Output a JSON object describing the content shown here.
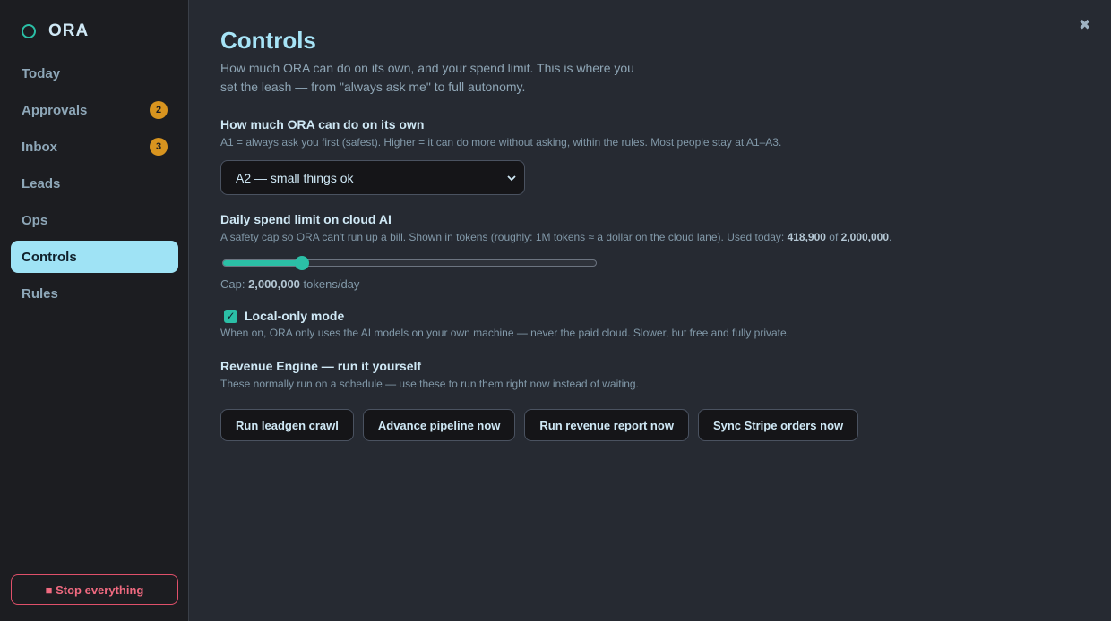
{
  "brand": {
    "name": "ORA",
    "accent": "#2bbfa6"
  },
  "nav": [
    {
      "label": "Today",
      "badge": ""
    },
    {
      "label": "Approvals",
      "badge": "2"
    },
    {
      "label": "Inbox",
      "badge": "3"
    },
    {
      "label": "Leads",
      "badge": ""
    },
    {
      "label": "Ops",
      "badge": ""
    },
    {
      "label": "Controls",
      "badge": "",
      "active": true
    },
    {
      "label": "Rules",
      "badge": ""
    }
  ],
  "stop_button": "■ Stop everything",
  "close_icon": "✖",
  "page": {
    "title": "Controls",
    "intro": "How much ORA can do on its own, and your spend limit. This is where you set the leash — from \"always ask me\" to full autonomy."
  },
  "autonomy": {
    "title": "How much ORA can do on its own",
    "desc": "A1 = always ask you first (safest). Higher = it can do more without asking, within the rules. Most people stay at A1–A3.",
    "selected": "A2 — small things ok",
    "chevron_icon": "⌄"
  },
  "spend": {
    "title": "Daily spend limit on cloud AI",
    "desc_prefix": "A safety cap so ORA can't run up a bill. Shown in tokens (roughly: 1M tokens ≈ a dollar on the cloud lane). Used today: ",
    "used": "418,900",
    "of": " of ",
    "cap_value": "2,000,000",
    "period": ".",
    "slider_level": 0.205,
    "cap_prefix": "Cap: ",
    "cap_suffix": " tokens/day"
  },
  "local_mode": {
    "label": "Local-only mode",
    "checked": true,
    "check_glyph": "✓",
    "desc": "When on, ORA only uses the AI models on your own machine — never the paid cloud. Slower, but free and fully private."
  },
  "revenue": {
    "title": "Revenue Engine — run it yourself",
    "desc": "These normally run on a schedule — use these to run them right now instead of waiting.",
    "actions": [
      "Run leadgen crawl",
      "Advance pipeline now",
      "Run revenue report now",
      "Sync Stripe orders now"
    ]
  }
}
